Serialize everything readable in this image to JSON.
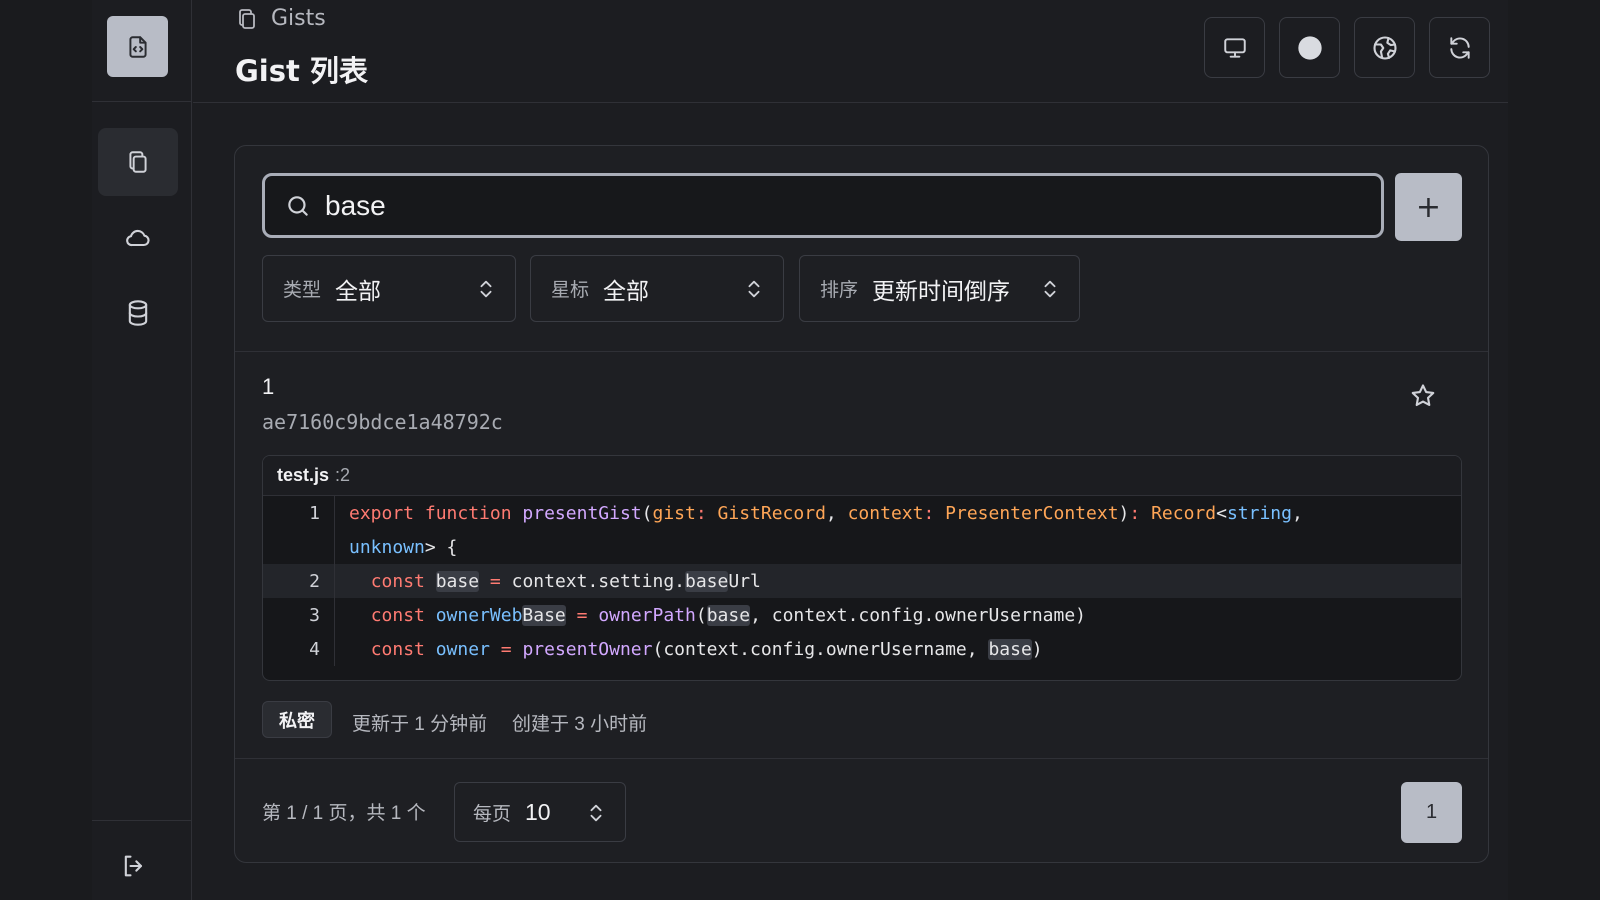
{
  "breadcrumb": {
    "label": "Gists"
  },
  "page": {
    "title": "Gist 列表"
  },
  "search": {
    "value": "base",
    "placeholder": ""
  },
  "add_button": {
    "label": "+"
  },
  "filters": [
    {
      "label": "类型",
      "value": "全部"
    },
    {
      "label": "星标",
      "value": "全部"
    },
    {
      "label": "排序",
      "value": "更新时间倒序"
    }
  ],
  "gist": {
    "title": "1",
    "id": "ae7160c9bdce1a48792c",
    "file": {
      "name": "test.js",
      "line_ref": ":2"
    },
    "code_lines": [
      {
        "num": "1",
        "text": "export function presentGist(gist: GistRecord, context: PresenterContext): Record<string,",
        "highlighted": false
      },
      {
        "num": "",
        "text": "unknown> {",
        "highlighted": false
      },
      {
        "num": "2",
        "text": "  const base = context.setting.baseUrl",
        "highlighted": true
      },
      {
        "num": "3",
        "text": "  const ownerWebBase = ownerPath(base, context.config.ownerUsername)",
        "highlighted": false
      },
      {
        "num": "4",
        "text": "  const owner = presentOwner(context.config.ownerUsername, base)",
        "highlighted": false
      }
    ],
    "visibility_badge": "私密",
    "updated": "更新于 1 分钟前",
    "created": "创建于 3 小时前"
  },
  "pagination": {
    "summary": "第 1 / 1 页，共 1 个",
    "per_page_label": "每页",
    "per_page_value": "10",
    "current_page": "1"
  },
  "icons": {
    "logo": "file-code-icon",
    "nav": [
      "gists-copy-icon",
      "cloud-icon",
      "database-icon"
    ],
    "header_buttons": [
      "monitor-icon",
      "circle-theme-icon",
      "globe-icon",
      "refresh-icon"
    ],
    "logout": "logout-icon"
  },
  "colors": {
    "accent_button": "#b8bcc6",
    "background": "#1c1d21"
  }
}
